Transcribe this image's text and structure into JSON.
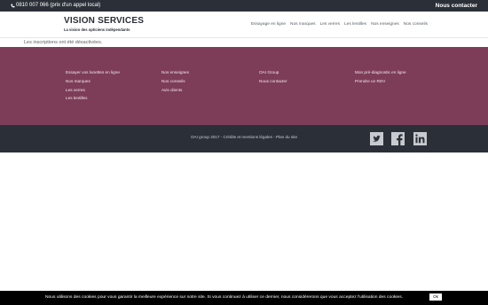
{
  "topbar": {
    "phone": "0810 007 066 (prix d'un appel local)",
    "contact_label": "Nous contacter"
  },
  "header": {
    "logo_title": "VISION SERVICES",
    "logo_subtitle": "La vision des opticiens indépendants",
    "nav": [
      "Essayage en ligne",
      "Nos marques",
      "Les verres",
      "Les lentilles",
      "Nos enseignes",
      "Nos conseils"
    ]
  },
  "notice": "Les inscriptions ont été désactivées.",
  "footer": {
    "col1": [
      "Essayer vos lunettes en ligne",
      "Nos marques",
      "Les verres",
      "Les lentilles"
    ],
    "col2": [
      "Nos enseignes",
      "Nos conseils",
      "Avis clients"
    ],
    "col3": [
      "OAI Group",
      "Nous contacter"
    ],
    "col4": [
      "Mon pré-diagnostic en ligne",
      "Prendre un RDV"
    ],
    "credits": "OAI group 2017 - Crédits et mentions légales - Plan du site",
    "social": [
      "twitter-icon",
      "facebook-icon",
      "linkedin-icon"
    ]
  },
  "cookie": {
    "message": "Nous utilisons des cookies pour vous garantir la meilleure expérience sur notre site. Si vous continuez à utiliser ce dernier, nous considérerons que vous acceptez l'utilisation des cookies.",
    "ok_label": "Ok"
  },
  "colors": {
    "topbar": "#2b3038",
    "footer_widgets": "#7d3d58",
    "footer_bottom": "#2b3038",
    "social_icons": "#c7cad0"
  }
}
